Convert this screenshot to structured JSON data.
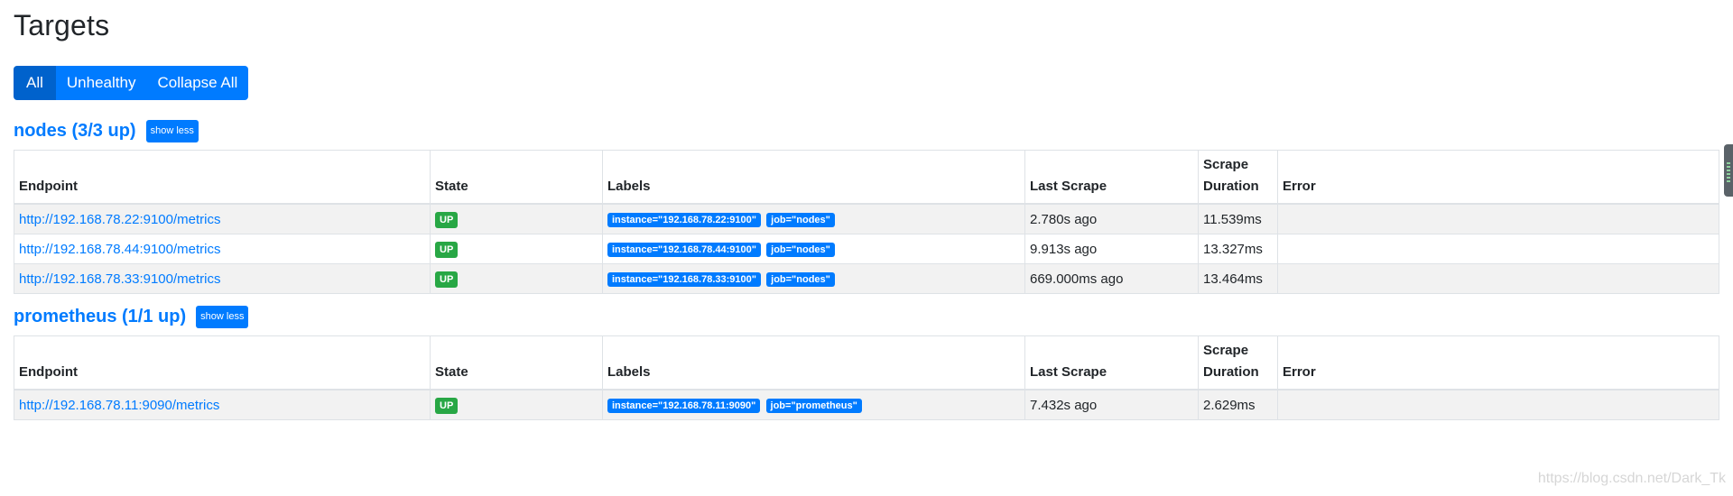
{
  "page": {
    "title": "Targets"
  },
  "filters": {
    "all": "All",
    "unhealthy": "Unhealthy",
    "collapse_all": "Collapse All"
  },
  "table_headers": {
    "endpoint": "Endpoint",
    "state": "State",
    "labels": "Labels",
    "last_scrape": "Last Scrape",
    "scrape_duration": "Scrape Duration",
    "error": "Error"
  },
  "groups": [
    {
      "title": "nodes (3/3 up)",
      "toggle_label": "show less",
      "rows": [
        {
          "endpoint": "http://192.168.78.22:9100/metrics",
          "state": "UP",
          "labels": [
            "instance=\"192.168.78.22:9100\"",
            "job=\"nodes\""
          ],
          "last_scrape": "2.780s ago",
          "duration": "11.539ms",
          "error": ""
        },
        {
          "endpoint": "http://192.168.78.44:9100/metrics",
          "state": "UP",
          "labels": [
            "instance=\"192.168.78.44:9100\"",
            "job=\"nodes\""
          ],
          "last_scrape": "9.913s ago",
          "duration": "13.327ms",
          "error": ""
        },
        {
          "endpoint": "http://192.168.78.33:9100/metrics",
          "state": "UP",
          "labels": [
            "instance=\"192.168.78.33:9100\"",
            "job=\"nodes\""
          ],
          "last_scrape": "669.000ms ago",
          "duration": "13.464ms",
          "error": ""
        }
      ]
    },
    {
      "title": "prometheus (1/1 up)",
      "toggle_label": "show less",
      "rows": [
        {
          "endpoint": "http://192.168.78.11:9090/metrics",
          "state": "UP",
          "labels": [
            "instance=\"192.168.78.11:9090\"",
            "job=\"prometheus\""
          ],
          "last_scrape": "7.432s ago",
          "duration": "2.629ms",
          "error": ""
        }
      ]
    }
  ],
  "watermark": "https://blog.csdn.net/Dark_Tk",
  "colors": {
    "primary": "#007bff",
    "primary_active": "#0062cc",
    "success": "#28a745"
  }
}
